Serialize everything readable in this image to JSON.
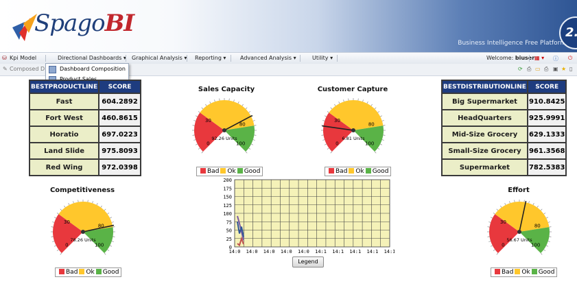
{
  "header": {
    "logo": "Spago",
    "logo_bi": "BI",
    "tagline": "Business Intelligence Free Platform",
    "version": "2."
  },
  "menubar": {
    "kpi_model": "Kpi Model",
    "items": [
      "Directional Dashboards",
      "Graphical Analysis",
      "Reporting",
      "Advanced Analysis",
      "Utility"
    ],
    "welcome_label": "Welcome:",
    "user": "biuser"
  },
  "toolbar2": {
    "breadcrumb": "Composed D"
  },
  "dropdown": {
    "items": [
      "Dashboard Composition",
      "Product Sales Distribution"
    ]
  },
  "left_table": {
    "headers": [
      "BESTPRODUCTLINE",
      "SCORE"
    ],
    "rows": [
      [
        "Fast",
        "604.2892"
      ],
      [
        "Fort West",
        "460.8615"
      ],
      [
        "Horatio",
        "697.0223"
      ],
      [
        "Land Slide",
        "975.8093"
      ],
      [
        "Red Wing",
        "972.0398"
      ]
    ]
  },
  "right_table": {
    "headers": [
      "BESTDISTRIBUTIONLINE",
      "SCORE"
    ],
    "rows": [
      [
        "Big Supermarket",
        "910.8425"
      ],
      [
        "HeadQuarters",
        "925.9991"
      ],
      [
        "Mid-Size Grocery",
        "629.1333"
      ],
      [
        "Small-Size Grocery",
        "961.3568"
      ],
      [
        "Supermarket",
        "782.5383"
      ]
    ]
  },
  "gauges": [
    {
      "id": "sales",
      "title": "Sales Capacity",
      "value_label": "92.26 Units",
      "needle_angle": 62,
      "tick_labels": [
        "0",
        "30",
        "80",
        "100"
      ]
    },
    {
      "id": "customer",
      "title": "Customer Capture",
      "value_label": "6.81 Units",
      "needle_angle": -82,
      "tick_labels": [
        "0",
        "30",
        "80",
        "100"
      ]
    },
    {
      "id": "competitiveness",
      "title": "Competitiveness",
      "value_label": "78.26 Units",
      "needle_angle": 78,
      "tick_labels": [
        "0",
        "30",
        "80",
        "100"
      ]
    },
    {
      "id": "effort",
      "title": "Effort",
      "value_label": "56.67 Units",
      "needle_angle": 12,
      "tick_labels": [
        "0",
        "30",
        "80",
        "100"
      ]
    }
  ],
  "legend": {
    "bad": "Bad",
    "ok": "Ok",
    "good": "Good"
  },
  "colors": {
    "bad": "#e8383d",
    "ok": "#ffc72c",
    "good": "#5ab347",
    "header_blue": "#1e3c7f"
  },
  "line_chart": {
    "y_ticks": [
      "200",
      "175",
      "150",
      "125",
      "100",
      "75",
      "50",
      "25",
      "0"
    ],
    "x_ticks": [
      "14:0",
      "14:0",
      "14:0",
      "14:0",
      "14:0",
      "14:1",
      "14:1",
      "14:1",
      "14:1",
      "14:1"
    ],
    "legend_button": "Legend"
  },
  "chart_data": {
    "type": "line",
    "x": [
      "14:0",
      "14:0",
      "14:0",
      "14:0",
      "14:0",
      "14:1",
      "14:1",
      "14:1",
      "14:1",
      "14:1"
    ],
    "ylim": [
      0,
      200
    ],
    "series": [
      {
        "values": [
          92,
          70,
          45,
          20
        ]
      },
      {
        "values": [
          75,
          40,
          60,
          30
        ]
      },
      {
        "values": [
          10,
          5,
          25,
          8
        ]
      }
    ],
    "series_colors": [
      "#7a5aa6",
      "#2f5597",
      "#c0504d"
    ],
    "grid": true
  }
}
